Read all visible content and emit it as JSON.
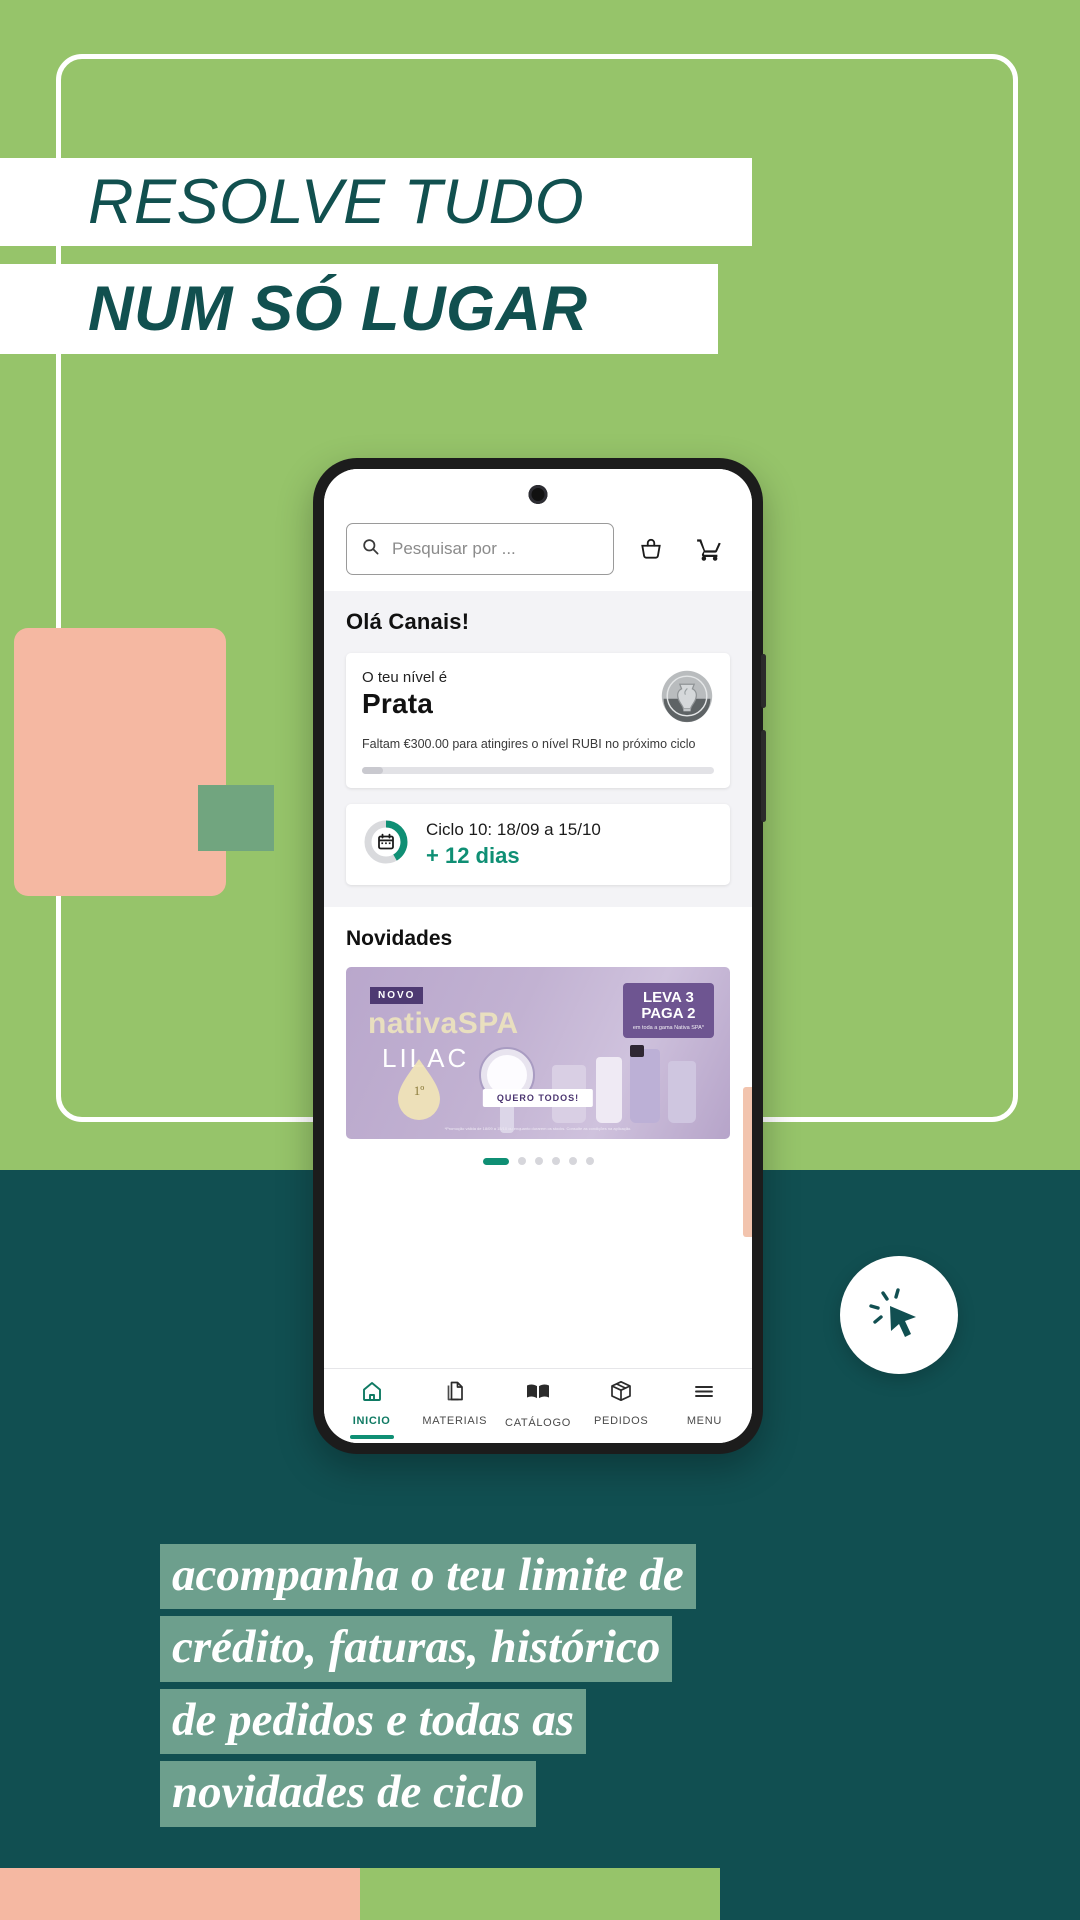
{
  "poster": {
    "headline_line1": "RESOLVE TUDO",
    "headline_line2": "NUM SÓ LUGAR",
    "paragraph_lines": [
      "acompanha o teu limite de",
      "crédito, faturas, histórico",
      "de pedidos e todas as",
      "novidades de ciclo"
    ],
    "colors": {
      "green": "#96c46a",
      "teal": "#114f51",
      "peach": "#f5b8a2",
      "sage": "#6d9f8d",
      "headline_text": "#11504f"
    }
  },
  "cursor_badge": {
    "icon": "click-cursor-icon"
  },
  "phone": {
    "appbar": {
      "search": {
        "placeholder": "Pesquisar por ...",
        "value": "",
        "icon": "search-icon"
      },
      "basket_icon": "basket-icon",
      "cart_icon": "shopping-cart-icon"
    },
    "greeting": "Olá Canais!",
    "level_card": {
      "label": "O teu nível é",
      "level_name": "Prata",
      "note": "Faltam €300.00 para atingires o nível RUBI no próximo ciclo",
      "badge_icon": "silver-trophy-badge-icon",
      "progress_percent": 6
    },
    "cycle_card": {
      "icon": "calendar-icon",
      "title": "Ciclo 10: 18/09 a 15/10",
      "remaining": "+ 12 dias",
      "ring_percent": 42,
      "accent_color": "#0f8f74"
    },
    "news": {
      "title": "Novidades",
      "banner": {
        "tag": "NOVO",
        "brand": "nativaSPA",
        "brand_sub": "LILAC",
        "promo_line1": "LEVA 3",
        "promo_line2": "PAGA 2",
        "promo_note": "em toda a gama Nativa SPA*",
        "cta": "QUERO TODOS!",
        "footer": "*Promoção válida de 18/09 a 15/10 ou enquanto durarem os stocks. Consulte as condições na aplicação."
      },
      "dots_total": 6,
      "dots_active_index": 0
    },
    "nav": [
      {
        "label": "INICIO",
        "icon": "home-icon",
        "active": true
      },
      {
        "label": "MATERIAIS",
        "icon": "documents-icon",
        "active": false
      },
      {
        "label": "CATÁLOGO",
        "icon": "book-icon",
        "active": false
      },
      {
        "label": "PEDIDOS",
        "icon": "box-icon",
        "active": false
      },
      {
        "label": "MENU",
        "icon": "hamburger-menu-icon",
        "active": false
      }
    ]
  }
}
